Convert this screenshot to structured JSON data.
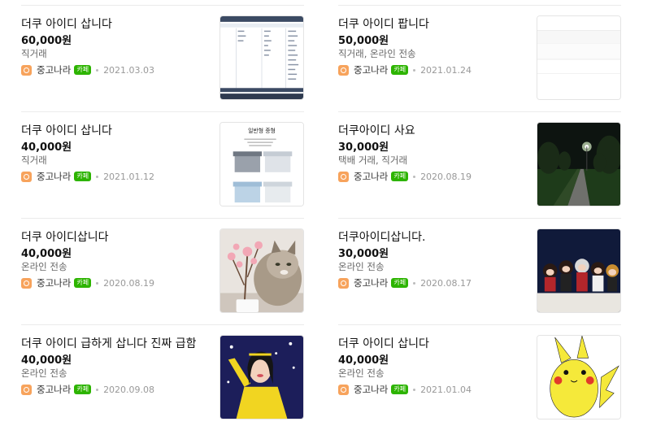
{
  "listings": {
    "left": [
      {
        "title": "더쿠 아이디 삽니다",
        "price": "60,000원",
        "method": "직거래",
        "seller": "중고나라",
        "cafe": "카페",
        "date": "2021.03.03",
        "thumb": "spreadsheet-screenshot"
      },
      {
        "title": "더쿠 아이디 삽니다",
        "price": "40,000원",
        "method": "직거래",
        "seller": "중고나라",
        "cafe": "카페",
        "date": "2021.01.12",
        "thumb": "storage-box-photo",
        "thumb_text": "일반형 중형"
      },
      {
        "title": "더쿠 아이디삽니다",
        "price": "40,000원",
        "method": "온라인 전송",
        "seller": "중고나라",
        "cafe": "카페",
        "date": "2020.08.19",
        "thumb": "cat-with-flowers-photo"
      },
      {
        "title": "더쿠 아이디 급하게 삽니다 진짜 급함",
        "price": "40,000원",
        "method": "온라인 전송",
        "seller": "중고나라",
        "cafe": "카페",
        "date": "2020.09.08",
        "thumb": "performer-photo"
      }
    ],
    "right": [
      {
        "title": "더쿠 아이디 팝니다",
        "price": "50,000원",
        "method": "직거래, 온라인 전송",
        "seller": "중고나라",
        "cafe": "카페",
        "date": "2021.01.24",
        "thumb": "blank-form-screenshot"
      },
      {
        "title": "더쿠아이디 사요",
        "price": "30,000원",
        "method": "택배 거래, 직거래",
        "seller": "중고나라",
        "cafe": "카페",
        "date": "2020.08.19",
        "thumb": "night-park-path-photo"
      },
      {
        "title": "더쿠아이디삽니다.",
        "price": "30,000원",
        "method": "온라인 전송",
        "seller": "중고나라",
        "cafe": "카페",
        "date": "2020.08.17",
        "thumb": "figurines-photo"
      },
      {
        "title": "더쿠 아이디 삽니다",
        "price": "40,000원",
        "method": "온라인 전송",
        "seller": "중고나라",
        "cafe": "카페",
        "date": "2021.01.04",
        "thumb": "pikachu-drawing"
      }
    ]
  },
  "colors": {
    "cafe_badge": "#2db400",
    "seller_logo": "#f7a35c",
    "divider": "#ebebeb"
  }
}
